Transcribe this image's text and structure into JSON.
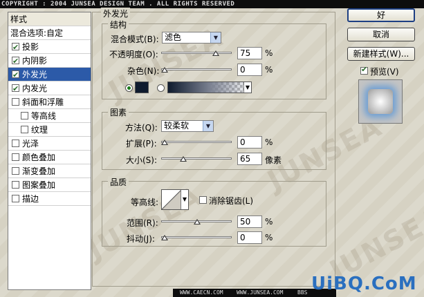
{
  "header_strip": "COPYRIGHT : 2004 JUNSEA DESIGN TEAM . ALL RIGHTS RESERVED",
  "watermark": "JUNSEA",
  "footer_strip": {
    "site1": "WWW.CAECN.COM",
    "site2": "WWW.JUNSEA.COM",
    "bbs": "BBS"
  },
  "logo": "UiBQ.CoM",
  "sidebar": {
    "title": "样式",
    "blending": "混合选项:自定",
    "items": [
      {
        "label": "投影",
        "checked": true
      },
      {
        "label": "内阴影",
        "checked": true
      },
      {
        "label": "外发光",
        "checked": true
      },
      {
        "label": "内发光",
        "checked": true
      },
      {
        "label": "斜面和浮雕",
        "checked": false
      },
      {
        "label": "等高线",
        "checked": false
      },
      {
        "label": "纹理",
        "checked": false
      },
      {
        "label": "光泽",
        "checked": false
      },
      {
        "label": "颜色叠加",
        "checked": false
      },
      {
        "label": "渐变叠加",
        "checked": false
      },
      {
        "label": "图案叠加",
        "checked": false
      },
      {
        "label": "描边",
        "checked": false
      }
    ]
  },
  "panel_title": "外发光",
  "structure": {
    "legend": "结构",
    "blend_mode_label": "混合模式(B):",
    "blend_mode_value": "滤色",
    "opacity_label": "不透明度(O):",
    "opacity_value": "75",
    "noise_label": "杂色(N):",
    "noise_value": "0",
    "unit": "%",
    "glow_color": "#0f1b2e"
  },
  "elements": {
    "legend": "图素",
    "method_label": "方法(Q):",
    "method_value": "较柔软",
    "spread_label": "扩展(P):",
    "spread_value": "0",
    "spread_unit": "%",
    "size_label": "大小(S):",
    "size_value": "65",
    "size_unit": "像素"
  },
  "quality": {
    "legend": "品质",
    "contour_label": "等高线:",
    "antialias_label": "消除锯齿(L)",
    "antialias_checked": false,
    "range_label": "范围(R):",
    "range_value": "50",
    "jitter_label": "抖动(J):",
    "jitter_value": "0",
    "unit": "%"
  },
  "buttons": {
    "ok": "好",
    "cancel": "取消",
    "new_style": "新建样式(W)...",
    "preview_label": "预览(V)",
    "preview_checked": true
  }
}
